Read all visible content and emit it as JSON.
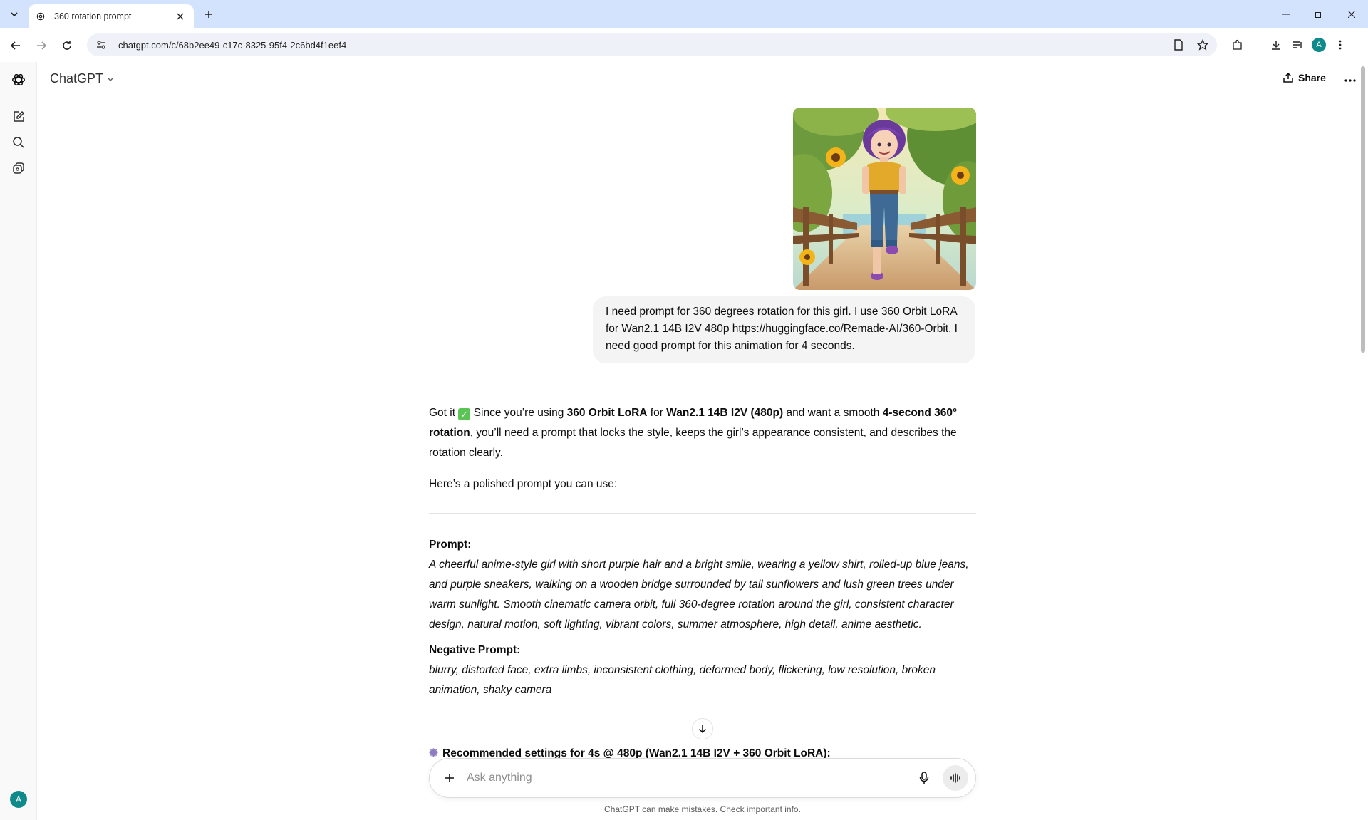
{
  "browser": {
    "tab_title": "360 rotation prompt",
    "url": "chatgpt.com/c/68b2ee49-c17c-8325-95f4-2c6bd4f1eef4",
    "profile_initial": "A"
  },
  "app": {
    "model_label": "ChatGPT",
    "share_label": "Share",
    "user_initial": "A"
  },
  "user_message": {
    "text": "I need prompt for 360 degrees rotation for this girl. I use 360 Orbit LoRA for Wan2.1 14B I2V 480p https://huggingface.co/Remade-AI/360-Orbit. I need good prompt for this animation for 4 seconds."
  },
  "assistant": {
    "intro_1": "Got it ",
    "check_mark": "✓",
    "intro_2": " Since you’re using ",
    "intro_b1": "360 Orbit LoRA",
    "intro_3": " for ",
    "intro_b2": "Wan2.1 14B I2V (480p)",
    "intro_4": " and want a smooth ",
    "intro_b3": "4-second 360° rotation",
    "intro_5": ", you’ll need a prompt that locks the style, keeps the girl’s appearance consistent, and describes the rotation clearly.",
    "lead": "Here’s a polished prompt you can use:",
    "prompt_label": "Prompt:",
    "prompt_text": "A cheerful anime-style girl with short purple hair and a bright smile, wearing a yellow shirt, rolled-up blue jeans, and purple sneakers, walking on a wooden bridge surrounded by tall sunflowers and lush green trees under warm sunlight. Smooth cinematic camera orbit, full 360-degree rotation around the girl, consistent character design, natural motion, soft lighting, vibrant colors, summer atmosphere, high detail, anime aesthetic.",
    "negative_label": "Negative Prompt:",
    "negative_text": "blurry, distorted face, extra limbs, inconsistent clothing, deformed body, flickering, low resolution, broken animation, shaky camera",
    "recommended": "Recommended settings for 4s @ 480p (Wan2.1 14B I2V + 360 Orbit LoRA):"
  },
  "composer": {
    "placeholder": "Ask anything"
  },
  "footer": {
    "disclaimer": "ChatGPT can make mistakes. Check important info."
  },
  "icons": {
    "tab_search": "chevron-down-icon",
    "back": "arrow-left-icon",
    "forward": "arrow-right-icon",
    "reload": "reload-icon",
    "site_info": "tune-icon",
    "page_info": "document-icon",
    "bookmark": "star-icon",
    "extensions": "puzzle-icon",
    "downloads": "download-icon",
    "media": "playlist-icon",
    "menu": "kebab-icon",
    "new_chat": "edit-icon",
    "search": "search-icon",
    "library": "images-icon"
  },
  "colors": {
    "tab_strip": "#d3e3fd",
    "accent_avatar": "#0f8a8a",
    "user_bubble": "#f4f4f4",
    "check": "#5ac454"
  }
}
